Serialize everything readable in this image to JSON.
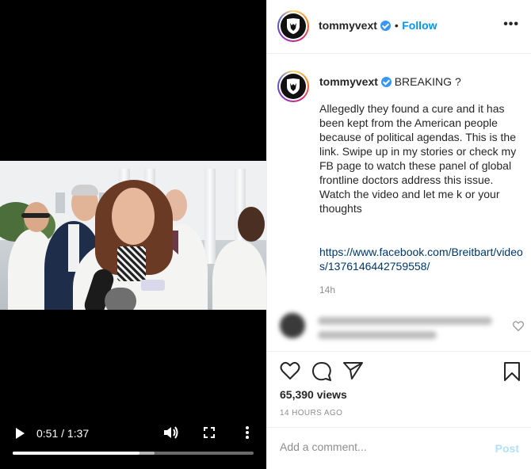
{
  "video": {
    "time_display": "0:51 / 1:37",
    "progress_fraction": 0.526,
    "buffered_fraction": 0.59,
    "controls": {
      "play_icon": "play-icon",
      "volume_icon": "volume-icon",
      "fullscreen_icon": "fullscreen-icon",
      "more_icon": "more-vertical-icon"
    }
  },
  "header": {
    "username": "tommyvext",
    "separator": "•",
    "follow_label": "Follow",
    "more_label": "•••"
  },
  "caption": {
    "username": "tommyvext",
    "headline": "BREAKING ?",
    "body": "Allegedly they found a cure and it has been kept from the American people because of political agendas. This is the link. Swipe up in my stories or check my FB page to watch these panel of global frontline doctors address this issue.\nWatch the video and let me k or your thoughts",
    "link": "https://www.facebook.com/Breitbart/videos/1376146442759558/",
    "age": "14h"
  },
  "actions": {
    "like_icon": "heart-icon",
    "comment_icon": "comment-icon",
    "share_icon": "send-icon",
    "save_icon": "bookmark-icon",
    "views": "65,390 views",
    "posted": "14 HOURS AGO"
  },
  "comment_box": {
    "placeholder": "Add a comment...",
    "post_label": "Post"
  },
  "colors": {
    "link_blue": "#0095f6",
    "caption_link": "#00376b",
    "muted": "#8e8e8e",
    "post_disabled": "#b2dffc"
  }
}
